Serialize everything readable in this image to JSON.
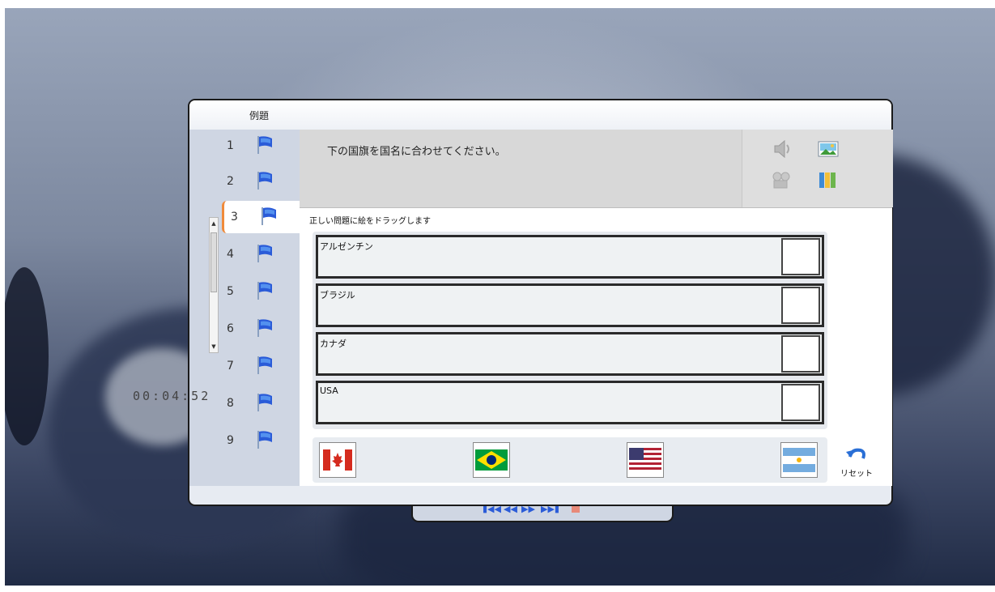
{
  "window": {
    "title": "例題"
  },
  "nav": {
    "items": [
      {
        "label": "1"
      },
      {
        "label": "2"
      },
      {
        "label": "3"
      },
      {
        "label": "4"
      },
      {
        "label": "5"
      },
      {
        "label": "6"
      },
      {
        "label": "7"
      },
      {
        "label": "8"
      },
      {
        "label": "9"
      }
    ],
    "active_index": 2
  },
  "question": {
    "text": "下の国旗を国名に合わせてください。"
  },
  "tools": [
    "speaker-icon",
    "picture-icon",
    "film-icon",
    "book-icon"
  ],
  "instruction": "正しい問題に絵をドラッグします",
  "answers": [
    {
      "label": "アルゼンチン"
    },
    {
      "label": "ブラジル"
    },
    {
      "label": "カナダ"
    },
    {
      "label": "USA"
    }
  ],
  "flags": [
    "canada-flag",
    "brazil-flag",
    "usa-flag",
    "argentina-flag"
  ],
  "reset": {
    "label": "リセット"
  },
  "timer": "00:04:52",
  "controls": [
    "first-icon",
    "previous-icon",
    "next-icon",
    "last-icon",
    "stop-icon"
  ],
  "colors": {
    "accent": "#f08a3a",
    "flag_blue": "#2a5bd8",
    "nav_bg": "#cfd6e3"
  }
}
